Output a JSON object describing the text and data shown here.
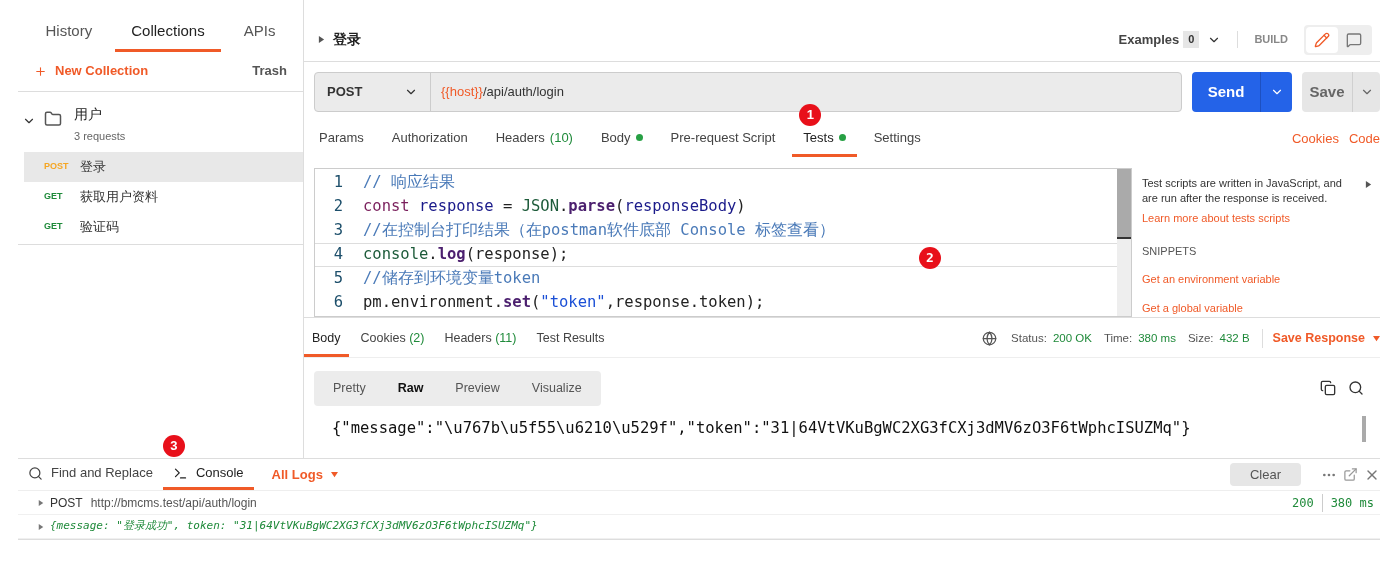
{
  "sidebar": {
    "tabs": [
      {
        "label": "History",
        "selected": false
      },
      {
        "label": "Collections",
        "selected": true
      },
      {
        "label": "APIs",
        "selected": false
      }
    ],
    "new_collection": "New Collection",
    "trash": "Trash",
    "collection": {
      "name": "用户",
      "count": "3 requests",
      "expanded": true,
      "requests": [
        {
          "method": "POST",
          "name": "登录",
          "selected": true
        },
        {
          "method": "GET",
          "name": "获取用户资料",
          "selected": false
        },
        {
          "method": "GET",
          "name": "验证码",
          "selected": false
        }
      ]
    }
  },
  "request": {
    "title": "登录",
    "examples_label": "Examples",
    "examples_count": "0",
    "build": "BUILD",
    "method": "POST",
    "url_var": "{{host}}",
    "url_path": "/api/auth/login",
    "send": "Send",
    "save": "Save",
    "modes": [
      {
        "kind": "edit",
        "selected": true
      },
      {
        "kind": "comment",
        "selected": false
      }
    ],
    "tabs": [
      {
        "label": "Params",
        "dot": false,
        "selected": false
      },
      {
        "label": "Authorization",
        "dot": false,
        "selected": false
      },
      {
        "label": "Headers",
        "count": "(10)",
        "dot": false,
        "selected": false
      },
      {
        "label": "Body",
        "dot": true,
        "selected": false
      },
      {
        "label": "Pre-request Script",
        "dot": false,
        "selected": false
      },
      {
        "label": "Tests",
        "dot": true,
        "selected": true
      },
      {
        "label": "Settings",
        "dot": false,
        "selected": false
      }
    ],
    "links": [
      "Cookies",
      "Code"
    ],
    "code_lines": [
      {
        "number": "1",
        "tokens": [
          {
            "t": "// 响应结果",
            "kind": "comment"
          }
        ]
      },
      {
        "number": "2",
        "tokens": [
          {
            "t": "const",
            "kind": "keyword"
          },
          {
            "t": " response ",
            "kind": "variable"
          },
          {
            "t": "=",
            "kind": "plain"
          },
          {
            "t": " JSON",
            "kind": "builtin"
          },
          {
            "t": ".",
            "kind": "plain"
          },
          {
            "t": "parse",
            "kind": "property"
          },
          {
            "t": "(",
            "kind": "plain"
          },
          {
            "t": "responseBody",
            "kind": "variable"
          },
          {
            "t": ")",
            "kind": "plain"
          }
        ]
      },
      {
        "number": "3",
        "tokens": [
          {
            "t": "//在控制台打印结果（在postman软件底部 Console 标签查看）",
            "kind": "comment"
          }
        ]
      },
      {
        "number": "4",
        "tokens": [
          {
            "t": "console",
            "kind": "builtin"
          },
          {
            "t": ".",
            "kind": "plain"
          },
          {
            "t": "log",
            "kind": "property"
          },
          {
            "t": "(response);",
            "kind": "plain"
          }
        ]
      },
      {
        "number": "5",
        "tokens": [
          {
            "t": "//储存到环境变量token",
            "kind": "comment"
          }
        ]
      },
      {
        "number": "6",
        "tokens": [
          {
            "t": "pm.environment.",
            "kind": "plain"
          },
          {
            "t": "set",
            "kind": "property"
          },
          {
            "t": "(",
            "kind": "plain"
          },
          {
            "t": "\"token\"",
            "kind": "string"
          },
          {
            "t": ",response.token);",
            "kind": "plain"
          }
        ]
      }
    ],
    "help_text": "Test scripts are written in JavaScript, and are run after the response is received.",
    "help_link": "Learn more about tests scripts",
    "snippets_title": "SNIPPETS",
    "snippets": [
      "Get an environment variable",
      "Get a global variable"
    ]
  },
  "response": {
    "tabs": [
      {
        "label": "Body",
        "selected": true
      },
      {
        "label": "Cookies",
        "count": "(2)",
        "selected": false
      },
      {
        "label": "Headers",
        "count": "(11)",
        "selected": false
      },
      {
        "label": "Test Results",
        "selected": false
      }
    ],
    "status_label": "Status:",
    "status": "200 OK",
    "time_label": "Time:",
    "time": "380 ms",
    "size_label": "Size:",
    "size": "432 B",
    "save_response": "Save Response",
    "formats": [
      {
        "label": "Pretty",
        "selected": false
      },
      {
        "label": "Raw",
        "selected": true
      },
      {
        "label": "Preview",
        "selected": false
      },
      {
        "label": "Visualize",
        "selected": false
      }
    ],
    "body": "{\"message\":\"\\u767b\\u5f55\\u6210\\u529f\",\"token\":\"31|64VtVKuBgWC2XG3fCXj3dMV6zO3F6tWphcISUZMq\"}"
  },
  "console": {
    "tabs": [
      {
        "label": "Find and Replace",
        "selected": false
      },
      {
        "label": "Console",
        "selected": true
      }
    ],
    "filter": "All Logs",
    "clear": "Clear",
    "entries": [
      {
        "kind": "request",
        "method": "POST",
        "url": "http://bmcms.test/api/auth/login",
        "status": "200",
        "time": "380 ms"
      },
      {
        "kind": "object",
        "text": "{message: \"登录成功\", token: \"31|64VtVKuBgWC2XG3fCXj3dMV6zO3F6tWphcISUZMq\"}"
      }
    ]
  },
  "annotations": [
    "1",
    "2",
    "3"
  ]
}
